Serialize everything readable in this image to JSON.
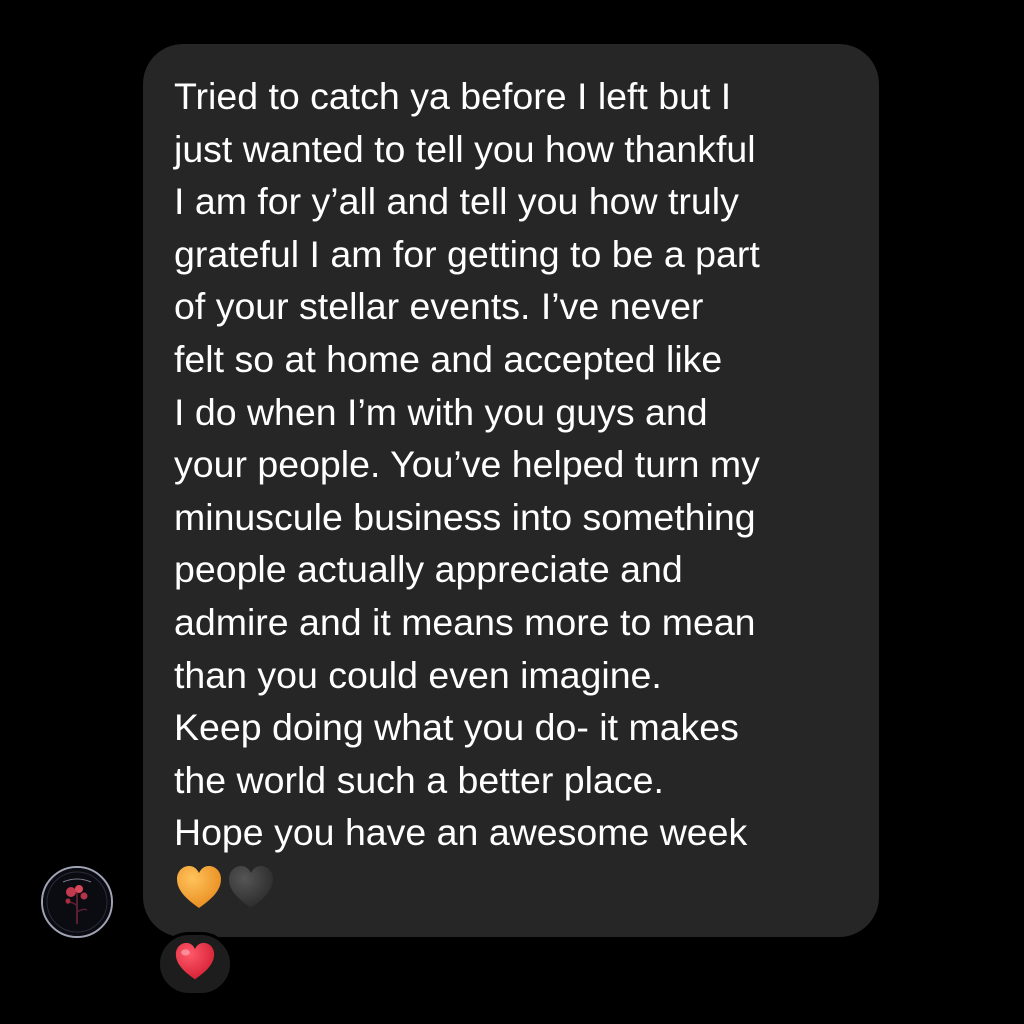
{
  "message": {
    "lines": [
      "Tried to catch ya before I left but I",
      "just wanted to tell you how thankful",
      "I am for y’all and tell you how truly",
      "grateful I am for getting to be a part",
      "of your stellar events. I’ve never",
      "felt so at home and accepted like",
      "I do when I’m with you guys and",
      "your people. You’ve helped turn my",
      "minuscule business into something",
      "people actually appreciate and",
      "admire and it means more to mean",
      "than you could even imagine.",
      "Keep doing what you do- it makes",
      "the world such a better place.",
      "Hope you have an awesome week"
    ],
    "hearts": [
      {
        "icon": "orange-heart-icon",
        "color": "#f2a33a"
      },
      {
        "icon": "black-heart-icon",
        "color": "#3a3a3a"
      }
    ]
  },
  "sender": {
    "avatar_icon": "avatar"
  },
  "reaction": {
    "icon": "red-heart-icon",
    "color": "#e0263a"
  },
  "colors": {
    "background": "#000000",
    "bubble": "#262626",
    "text": "#ffffff"
  }
}
